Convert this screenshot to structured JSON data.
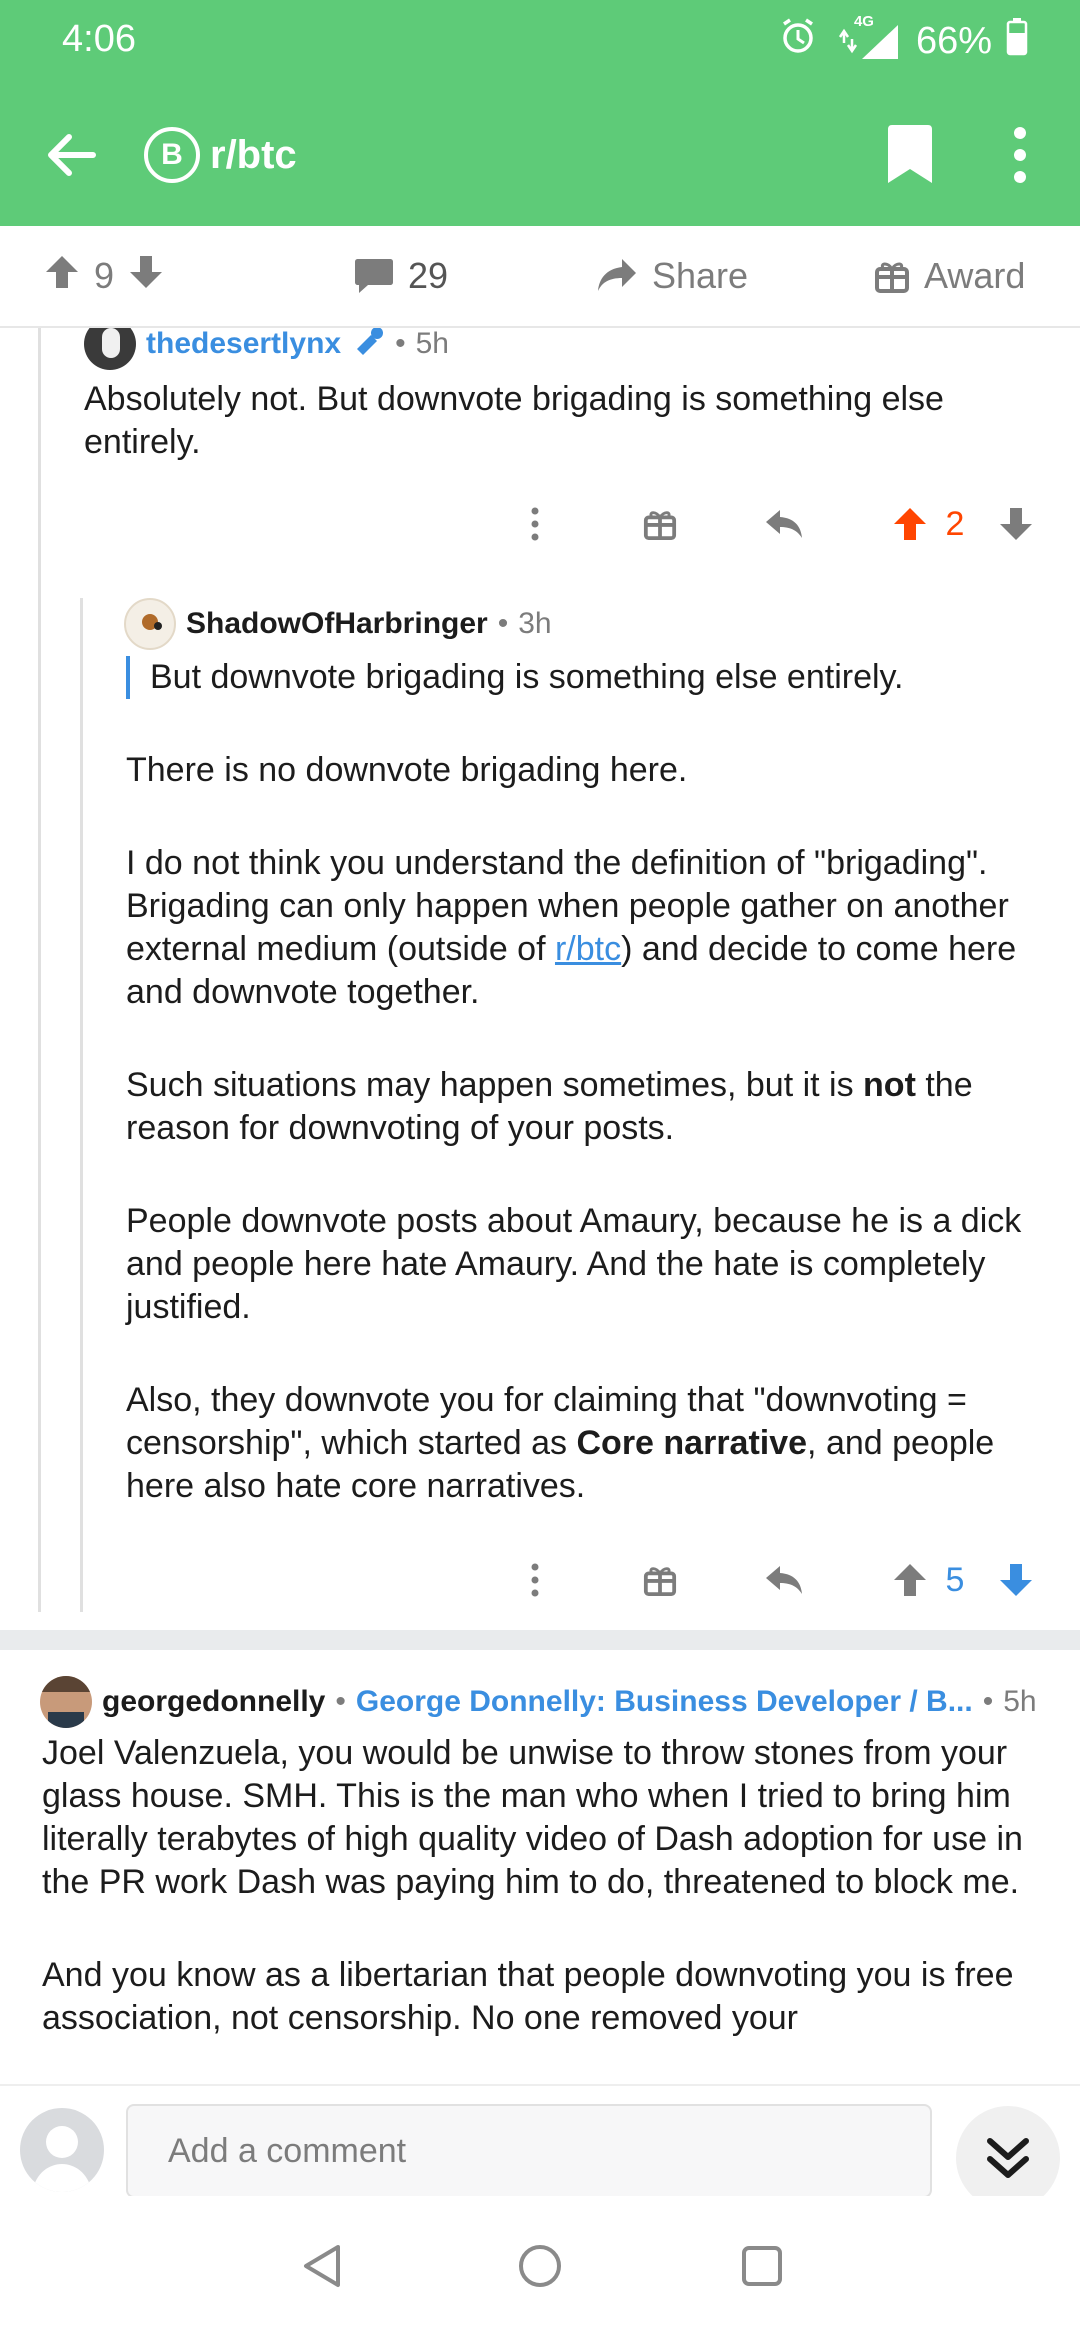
{
  "status": {
    "time": "4:06",
    "network": "4G",
    "battery": "66%"
  },
  "header": {
    "subreddit": "r/btc",
    "subreddit_icon_letter": "B"
  },
  "post_actions": {
    "upvotes": "9",
    "comments": "29",
    "share_label": "Share",
    "award_label": "Award"
  },
  "comment1": {
    "author": "thedesertlynx",
    "time": "5h",
    "text": "Absolutely not. But downvote brigading is something else entirely.",
    "votes": "2"
  },
  "comment2": {
    "author": "ShadowOfHarbringer",
    "time": "3h",
    "quote": "But downvote brigading is something else entirely.",
    "p1": "There is no downvote brigading here.",
    "p2_a": "I do not think you understand the definition of \"brigading\". Brigading can only happen when people gather on another external medium (outside of ",
    "p2_link": "r/btc",
    "p2_b": ") and decide to come here and downvote together.",
    "p3_a": "Such situations may happen sometimes, but it is ",
    "p3_bold": "not",
    "p3_b": " the reason for downvoting of your posts.",
    "p4": "People downvote posts about Amaury, because he is a dick and people here hate Amaury. And the hate is completely justified.",
    "p5_a": "Also, they downvote you for claiming that \"downvoting = censorship\", which started as ",
    "p5_bold": "Core narrative",
    "p5_b": ", and people here also hate core narratives.",
    "votes": "5"
  },
  "comment3": {
    "author": "georgedonnelly",
    "flair": "George Donnelly: Business Developer / B...",
    "time": "5h",
    "p1": "Joel Valenzuela, you would be unwise to throw stones from your glass house. SMH. This is the man who when I tried to bring him literally terabytes of high quality video of Dash adoption for use in the PR work Dash was paying him to do, threatened to block me.",
    "p2": "And you know as a libertarian that people downvoting you is free association, not censorship. No one removed your"
  },
  "composer": {
    "placeholder": "Add a comment"
  },
  "colors": {
    "header": "#5ecb78",
    "upvote_active": "#ff4500",
    "downvote_active": "#3a8ee0",
    "link": "#3a8ee0"
  }
}
